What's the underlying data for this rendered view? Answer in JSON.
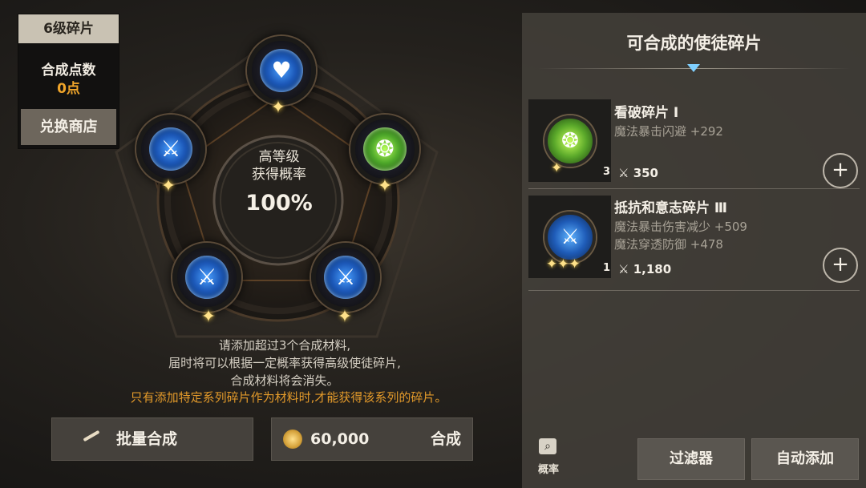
{
  "level_card": {
    "title": "6级碎片",
    "points_label": "合成点数",
    "points_value": "0点",
    "shop_button": "兑换商店"
  },
  "center": {
    "line1": "高等级",
    "line2": "获得概率",
    "percent": "100%"
  },
  "sockets": [
    {
      "position": "top",
      "icon": "heart-shield-icon",
      "color": "#2f7fe0",
      "stars": "✦"
    },
    {
      "position": "upper-left",
      "icon": "shield-sword-icon",
      "color": "#2f7fe0",
      "stars": "✦"
    },
    {
      "position": "upper-right",
      "icon": "green-rune-icon",
      "color": "#5aa82a",
      "stars": "✦"
    },
    {
      "position": "lower-left",
      "icon": "shield-sword-icon",
      "color": "#2f7fe0",
      "stars": "✦"
    },
    {
      "position": "lower-right",
      "icon": "shield-sword-icon",
      "color": "#2f7fe0",
      "stars": "✦"
    }
  ],
  "info": {
    "line1": "请添加超过3个合成材料,",
    "line2": "届时将可以根据一定概率获得高级使徒碎片,",
    "line3": "合成材料将会消失。",
    "warning": "只有添加特定系列碎片作为材料时,才能获得该系列的碎片。"
  },
  "buttons": {
    "batch": "批量合成",
    "cost": "60,000",
    "synthesize": "合成",
    "probability": "概率",
    "filter": "过滤器",
    "auto_add": "自动添加"
  },
  "right_panel": {
    "title": "可合成的使徒碎片",
    "items": [
      {
        "name": "看破碎片 Ⅰ",
        "stats": [
          "魔法暴击闪避 +292"
        ],
        "count": "3",
        "power": "350",
        "stars": "✦",
        "orb": "green"
      },
      {
        "name": "抵抗和意志碎片 Ⅲ",
        "stats": [
          "魔法暴击伤害减少 +509",
          "魔法穿透防御 +478"
        ],
        "count": "1",
        "power": "1,180",
        "stars": "✦✦✦",
        "orb": "blue"
      }
    ]
  },
  "colors": {
    "accent_orange": "#f0a52a",
    "warning_orange": "#e39a2a",
    "star_gold": "#ffe28a"
  }
}
